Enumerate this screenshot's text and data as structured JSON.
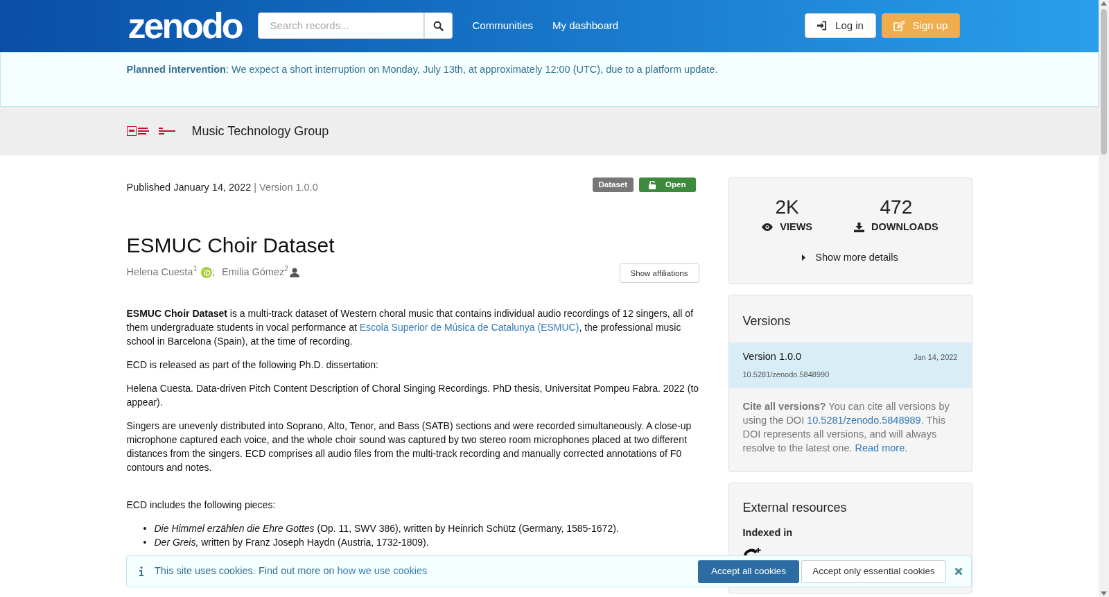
{
  "header": {
    "logo": "zenodo",
    "search": {
      "placeholder": "Search records..."
    },
    "nav": [
      "Communities",
      "My dashboard"
    ],
    "login": "Log in",
    "signup": "Sign up"
  },
  "notice": {
    "title": "Planned intervention",
    "text": ": We expect a short interruption on Monday, July 13th, at approximately 12:00 (UTC), due to a platform update."
  },
  "community": {
    "name": "Music Technology Group"
  },
  "record": {
    "published": "Published January 14, 2022",
    "version": "| Version 1.0.0",
    "badges": [
      {
        "kind": "type",
        "text": "Dataset"
      },
      {
        "kind": "access",
        "text": "Open"
      }
    ],
    "title": "ESMUC Choir Dataset",
    "creators": [
      {
        "name": "Helena Cuesta",
        "sup": "1",
        "kind": "orcid",
        "sep": ";"
      },
      {
        "name": "Emilia Gómez",
        "sup": "2",
        "kind": "person"
      }
    ],
    "show_affiliations": "Show affiliations",
    "paragraphs": [
      {
        "parts": [
          {
            "kind": "bold",
            "text": "ESMUC Choir Dataset"
          },
          {
            "kind": "text",
            "text": " is a multi-track dataset of Western choral music that contains individual audio recordings of 12 singers, all of them undergraduate students in vocal performance at "
          },
          {
            "kind": "link",
            "text": "Escola Superior de Música de Catalunya (ESMUC)"
          },
          {
            "kind": "text",
            "text": ", the professional music school in Barcelona (Spain), at the time of recording."
          }
        ]
      },
      {
        "parts": [
          {
            "kind": "text",
            "text": "ECD is released as part of the following Ph.D. dissertation:"
          }
        ]
      },
      {
        "parts": [
          {
            "kind": "text",
            "text": "Helena Cuesta. Data-driven Pitch Content Description of Choral Singing Recordings. PhD thesis, Universitat Pompeu Fabra. 2022 (to appear)."
          }
        ]
      },
      {
        "parts": [
          {
            "kind": "text",
            "text": "Singers are unevenly distributed into Soprano, Alto, Tenor, and Bass (SATB) sections and were recorded simultaneously. A close-up microphone captured each voice, and the whole choir sound was captured by two stereo room microphones placed at two different distances from the singers. ECD comprises all audio files from the multi-track recording and manually corrected annotations of F0 contours and notes."
          }
        ]
      },
      {
        "parts": [
          {
            "kind": "text",
            "text": "ECD includes the following pieces:"
          }
        ]
      }
    ],
    "pieces": [
      {
        "marker": "•",
        "parts": [
          {
            "kind": "italic",
            "text": "Die Himmel erzählen die Ehre Gottes"
          },
          {
            "kind": "text",
            "text": " (Op. 11, SWV 386), written by Heinrich Schütz (Germany, 1585-1672)."
          }
        ]
      },
      {
        "marker": "•",
        "parts": [
          {
            "kind": "italic",
            "text": "Der Greis,"
          },
          {
            "kind": "text",
            "text": " written by Franz Joseph Haydn (Austria, 1732-1809)."
          }
        ]
      }
    ]
  },
  "stats": [
    {
      "kind": "views",
      "value": "2K",
      "label": "VIEWS"
    },
    {
      "kind": "downloads",
      "value": "472",
      "label": "DOWNLOADS"
    }
  ],
  "more_details": "Show more details",
  "versions": {
    "title": "Versions",
    "items": [
      {
        "name": "Version 1.0.0",
        "date": "Jan 14, 2022",
        "doi": "10.5281/zenodo.5848990",
        "selected": true
      }
    ],
    "cite": {
      "bold": "Cite all versions?",
      "text1": " You can cite all versions by using the DOI ",
      "doi": "10.5281/zenodo.5848989",
      "text2": ". This DOI represents all versions, and will always resolve to the latest one. ",
      "link": "Read more",
      "end": "."
    }
  },
  "external": {
    "title": "External resources",
    "subtitle": "Indexed in"
  },
  "cookies": {
    "text": "This site uses cookies. Find out more on ",
    "link": "how we use cookies",
    "accept_all": "Accept all cookies",
    "accept_essential": "Accept only essential cookies"
  }
}
